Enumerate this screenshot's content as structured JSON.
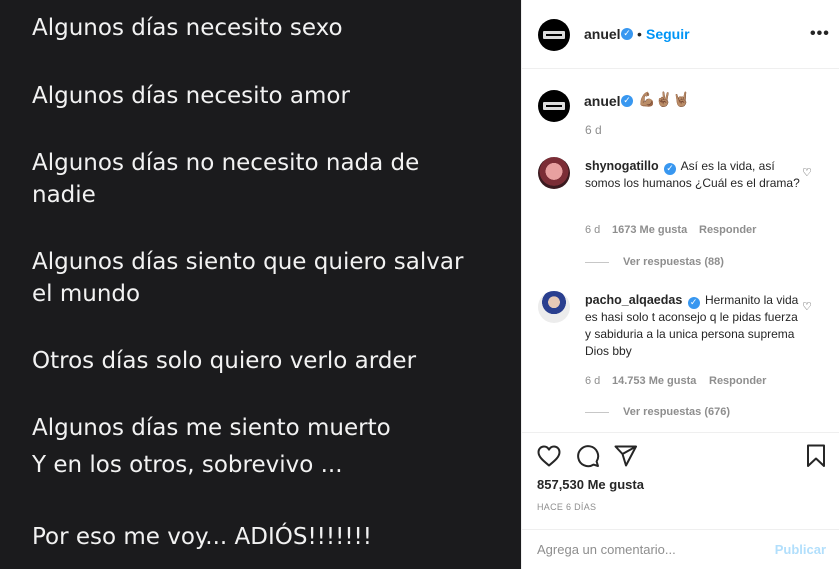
{
  "media": {
    "lines": [
      "Algunos días necesito sexo",
      "Algunos días necesito amor",
      "Algunos días no necesito nada de",
      "nadie",
      "Algunos días siento que quiero salvar",
      "el mundo",
      "Otros días solo quiero verlo arder",
      "Algunos días me siento muerto",
      "Y en los otros, sobrevivo ...",
      "Por eso me voy... ADIÓS!!!!!!!"
    ]
  },
  "header": {
    "username": "anuel",
    "separator": "•",
    "follow_label": "Seguir",
    "more_label": "•••"
  },
  "caption": {
    "username": "anuel",
    "emoji": "💪🏽✌🏽🤘🏽",
    "age": "6 d"
  },
  "comments": [
    {
      "username": "shynogatillo",
      "text": "Así es la vida, así somos los humanos ¿Cuál es el drama?",
      "age": "6 d",
      "likes": "1673 Me gusta",
      "reply_label": "Responder",
      "view_replies": "Ver respuestas (88)"
    },
    {
      "username": "pacho_alqaedas",
      "text": "Hermanito la vida es hasi solo t aconsejo q le pidas fuerza y sabiduria a la unica persona suprema Dios bby",
      "age": "6 d",
      "likes": "14.753 Me gusta",
      "reply_label": "Responder",
      "view_replies": "Ver respuestas (676)"
    }
  ],
  "actions": {
    "likes": "857,530 Me gusta",
    "date": "HACE 6 DÍAS"
  },
  "composer": {
    "placeholder": "Agrega un comentario...",
    "post_label": "Publicar"
  },
  "colors": {
    "accent": "#0095f6",
    "verified": "#3897f0",
    "muted": "#8e8e8e",
    "media_bg": "#1b1b1d"
  }
}
